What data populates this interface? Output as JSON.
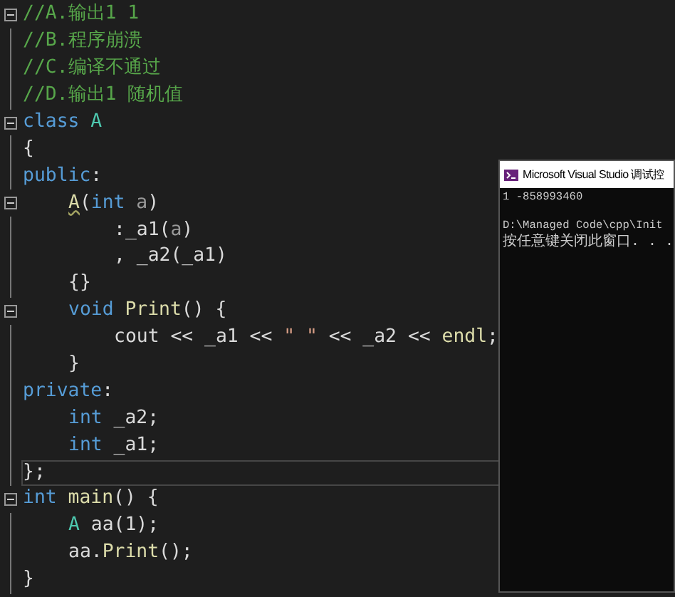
{
  "editor": {
    "lines": [
      {
        "kind": "top",
        "fold": true,
        "tokens": [
          {
            "kind": "comment",
            "text": "//A.输出1 1"
          }
        ]
      },
      {
        "kind": "top",
        "fold": false,
        "tokens": [
          {
            "kind": "comment",
            "text": "//B.程序崩溃"
          }
        ]
      },
      {
        "kind": "top",
        "fold": false,
        "tokens": [
          {
            "kind": "comment",
            "text": "//C.编译不通过"
          }
        ]
      },
      {
        "kind": "top",
        "fold": false,
        "tokens": [
          {
            "kind": "comment",
            "text": "//D.输出1 随机值"
          }
        ]
      },
      {
        "kind": "top",
        "fold": true,
        "tokens": [
          {
            "kind": "keyword",
            "text": "class "
          },
          {
            "kind": "type",
            "text": "A"
          }
        ]
      },
      {
        "kind": "top",
        "fold": false,
        "tokens": [
          {
            "kind": "plain",
            "text": "{"
          }
        ]
      },
      {
        "kind": "top",
        "fold": false,
        "tokens": [
          {
            "kind": "keyword",
            "text": "public"
          },
          {
            "kind": "plain",
            "text": ":"
          }
        ]
      },
      {
        "kind": "member",
        "fold": true,
        "tokens": [
          {
            "kind": "function",
            "text": "A",
            "warning": true
          },
          {
            "kind": "plain",
            "text": "("
          },
          {
            "kind": "keyword",
            "text": "int "
          },
          {
            "kind": "param",
            "text": "a"
          },
          {
            "kind": "plain",
            "text": ")"
          }
        ]
      },
      {
        "kind": "body",
        "fold": false,
        "tokens": [
          {
            "kind": "plain",
            "text": ":_a1("
          },
          {
            "kind": "param",
            "text": "a"
          },
          {
            "kind": "plain",
            "text": ")"
          }
        ]
      },
      {
        "kind": "body",
        "fold": false,
        "tokens": [
          {
            "kind": "plain",
            "text": ", _a2(_a1)"
          }
        ]
      },
      {
        "kind": "member",
        "fold": false,
        "tokens": [
          {
            "kind": "plain",
            "text": "{}"
          }
        ]
      },
      {
        "kind": "member",
        "fold": true,
        "tokens": [
          {
            "kind": "keyword",
            "text": "void "
          },
          {
            "kind": "function",
            "text": "Print"
          },
          {
            "kind": "plain",
            "text": "() {"
          }
        ]
      },
      {
        "kind": "body",
        "fold": false,
        "tokens": [
          {
            "kind": "plain",
            "text": "cout << _a1 << "
          },
          {
            "kind": "string",
            "text": "\" \""
          },
          {
            "kind": "plain",
            "text": " << _a2 << "
          },
          {
            "kind": "function",
            "text": "endl"
          },
          {
            "kind": "plain",
            "text": ";"
          }
        ]
      },
      {
        "kind": "member",
        "fold": false,
        "tokens": [
          {
            "kind": "plain",
            "text": "}"
          }
        ]
      },
      {
        "kind": "top",
        "fold": false,
        "tokens": [
          {
            "kind": "keyword",
            "text": "private"
          },
          {
            "kind": "plain",
            "text": ":"
          }
        ]
      },
      {
        "kind": "member",
        "fold": false,
        "tokens": [
          {
            "kind": "keyword",
            "text": "int "
          },
          {
            "kind": "plain",
            "text": "_a2;"
          }
        ]
      },
      {
        "kind": "member",
        "fold": false,
        "tokens": [
          {
            "kind": "keyword",
            "text": "int "
          },
          {
            "kind": "plain",
            "text": "_a1;"
          }
        ]
      },
      {
        "kind": "top",
        "fold": false,
        "current": true,
        "tokens": [
          {
            "kind": "plain",
            "text": "};"
          }
        ]
      },
      {
        "kind": "top",
        "fold": true,
        "tokens": [
          {
            "kind": "keyword",
            "text": "int "
          },
          {
            "kind": "function",
            "text": "main"
          },
          {
            "kind": "plain",
            "text": "() {"
          }
        ]
      },
      {
        "kind": "member",
        "fold": false,
        "tokens": [
          {
            "kind": "type",
            "text": "A "
          },
          {
            "kind": "plain",
            "text": "aa(1);"
          }
        ]
      },
      {
        "kind": "member",
        "fold": false,
        "tokens": [
          {
            "kind": "plain",
            "text": "aa."
          },
          {
            "kind": "function",
            "text": "Print"
          },
          {
            "kind": "plain",
            "text": "();"
          }
        ]
      },
      {
        "kind": "top",
        "fold": false,
        "tokens": [
          {
            "kind": "plain",
            "text": "}"
          }
        ]
      }
    ]
  },
  "console": {
    "title": "Microsoft Visual Studio 调试控",
    "output": [
      "1 -858993460"
    ],
    "exit_message": [
      "D:\\Managed Code\\cpp\\Init",
      "按任意键关闭此窗口. . ."
    ]
  }
}
